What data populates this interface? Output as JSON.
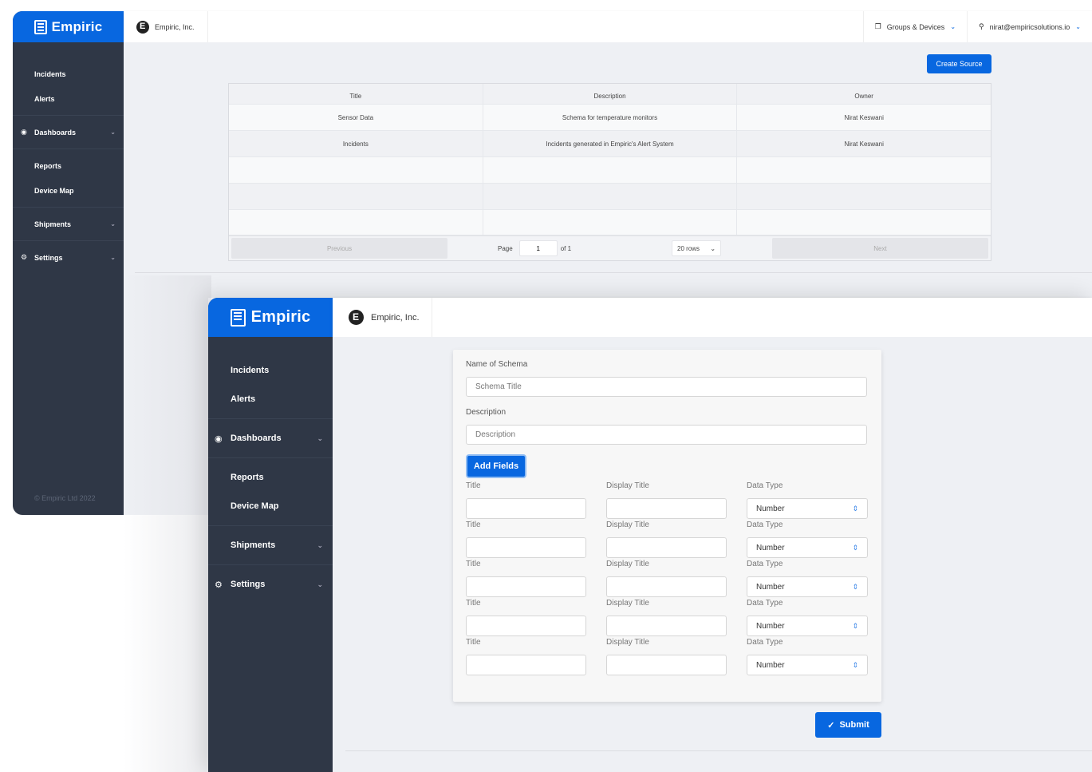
{
  "brand": {
    "name": "Empiric",
    "org": "Empiric, Inc.",
    "accent": "#0867e0",
    "sidebar_bg": "#2f3746"
  },
  "sidebar": {
    "items": [
      {
        "label": "Incidents"
      },
      {
        "label": "Alerts"
      },
      {
        "label": "Dashboards",
        "icon": "dashboard-icon",
        "expandable": true
      },
      {
        "label": "Reports"
      },
      {
        "label": "Device Map"
      },
      {
        "label": "Shipments",
        "expandable": true
      },
      {
        "label": "Settings",
        "icon": "gear-icon",
        "expandable": true
      }
    ],
    "copyright": "© Empiric Ltd 2022"
  },
  "topbar": {
    "groups_label": "Groups & Devices",
    "user_email": "nirat@empiricsolutions.io"
  },
  "sources": {
    "create_label": "Create Source",
    "columns": [
      "Title",
      "Description",
      "Owner"
    ],
    "rows": [
      [
        "Sensor Data",
        "Schema for temperature monitors",
        "Nirat Keswani"
      ],
      [
        "Incidents",
        "Incidents generated in Empiric's Alert System",
        "Nirat Keswani"
      ],
      [
        "",
        "",
        ""
      ],
      [
        "",
        "",
        ""
      ],
      [
        "",
        "",
        ""
      ]
    ],
    "pager": {
      "previous": "Previous",
      "next": "Next",
      "page_label": "Page",
      "page": "1",
      "of_label": "of 1",
      "rows_option": "20 rows"
    }
  },
  "schema_form": {
    "name_label": "Name of Schema",
    "name_placeholder": "Schema Title",
    "desc_label": "Description",
    "desc_placeholder": "Description",
    "add_fields_label": "Add Fields",
    "field_labels": {
      "title": "Title",
      "display_title": "Display Title",
      "data_type": "Data Type"
    },
    "fields": [
      {
        "title": "",
        "display_title": "",
        "data_type": "Number"
      },
      {
        "title": "",
        "display_title": "",
        "data_type": "Number"
      },
      {
        "title": "",
        "display_title": "",
        "data_type": "Number"
      },
      {
        "title": "",
        "display_title": "",
        "data_type": "Number"
      },
      {
        "title": "",
        "display_title": "",
        "data_type": "Number"
      }
    ],
    "submit_label": "Submit"
  }
}
